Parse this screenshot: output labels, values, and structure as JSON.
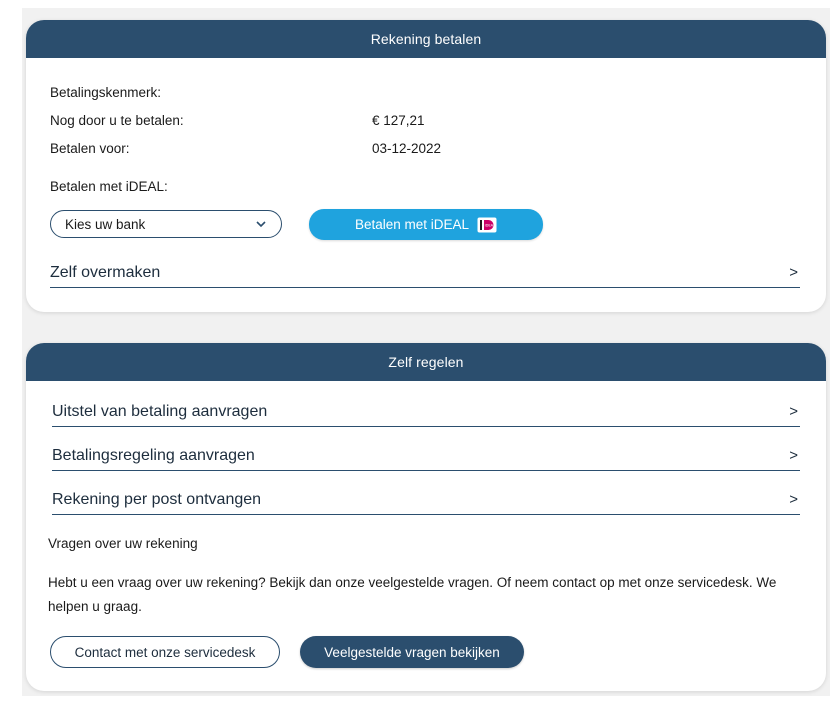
{
  "pay_card": {
    "title": "Rekening betalen",
    "kenmerk_label": "Betalingskenmerk:",
    "kenmerk_value": "",
    "amount_label": "Nog door u te betalen:",
    "amount_value": "€ 127,21",
    "due_label": "Betalen voor:",
    "due_value": "03-12-2022",
    "ideal_section_label": "Betalen met iDEAL:",
    "bank_select": {
      "value": "Kies uw bank",
      "icon": "chevron-down-icon"
    },
    "ideal_button_label": "Betalen met iDEAL",
    "ideal_logo_text": "iDEAL",
    "zelf_overmaken_label": "Zelf overmaken",
    "arrow": ">"
  },
  "self_card": {
    "title": "Zelf regelen",
    "links": [
      {
        "label": "Uitstel van betaling aanvragen",
        "arrow": ">"
      },
      {
        "label": "Betalingsregeling aanvragen",
        "arrow": ">"
      },
      {
        "label": "Rekening per post ontvangen",
        "arrow": ">"
      }
    ],
    "questions_title": "Vragen over uw rekening",
    "questions_text": "Hebt u een vraag over uw rekening? Bekijk dan onze veelgestelde vragen. Of neem contact op met onze servicedesk. We helpen u graag.",
    "contact_button_label": "Contact met onze servicedesk",
    "faq_button_label": "Veelgestelde vragen bekijken"
  },
  "colors": {
    "header": "#2b4e6e",
    "ideal_button": "#1fa3de",
    "ideal_logo": "#cc0066",
    "page_bg": "#f1f1f1"
  }
}
